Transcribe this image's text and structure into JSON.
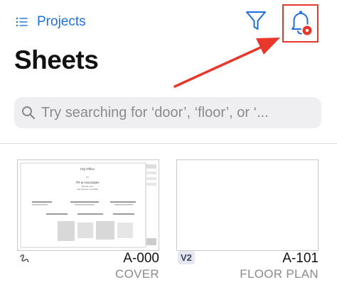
{
  "nav": {
    "back_label": "Projects"
  },
  "header": {
    "title": "Sheets"
  },
  "search": {
    "placeholder": "Try searching for ‘door’, ‘floor’, or ‘..."
  },
  "icons": {
    "back": "list-icon",
    "filter": "filter-funnel-icon",
    "notifications": "bell-icon",
    "search": "search-icon",
    "markup": "pen-squiggle-icon"
  },
  "colors": {
    "accent": "#1e6fd9",
    "annotation": "#e8372b",
    "notification_dot": "#e8372b"
  },
  "sheets": [
    {
      "number": "A-000",
      "name": "COVER",
      "thumbnail_text": {
        "title": "HQ Office",
        "line_by": "for",
        "firm": "TR & Associates",
        "address1": "88 Suite Lane",
        "address2": "San Francisco, CA 94110"
      }
    },
    {
      "number": "A-101",
      "name": "FLOOR PLAN",
      "version": "V2"
    }
  ]
}
